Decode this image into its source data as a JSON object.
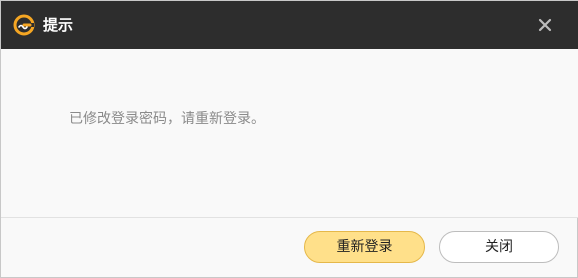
{
  "window": {
    "title": "提示",
    "logo_icon": "app-logo-icon",
    "close_icon": "close-icon"
  },
  "dialog": {
    "message": "已修改登录密码，请重新登录。"
  },
  "buttons": {
    "relogin_label": "重新登录",
    "close_label": "关闭"
  },
  "colors": {
    "titlebar_bg": "#2d2d2d",
    "primary_button_bg": "#ffe08a",
    "primary_button_border": "#e5b84a",
    "logo_accent": "#f5a623"
  }
}
